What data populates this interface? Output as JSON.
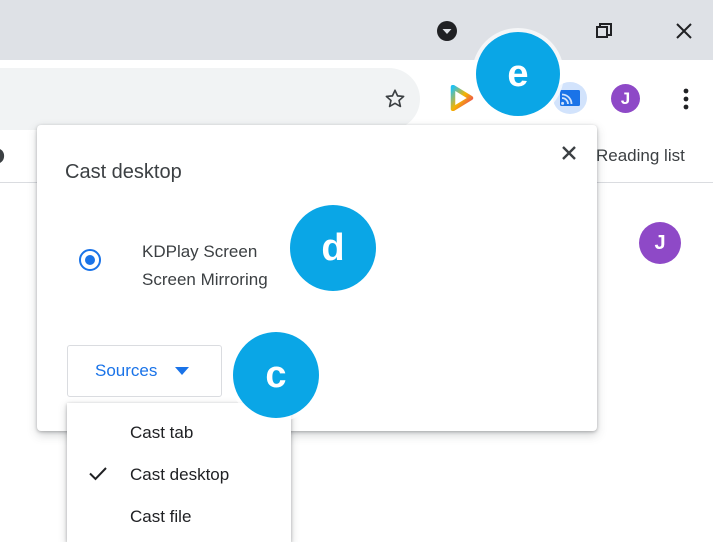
{
  "browser": {
    "profile_initial": "J",
    "cast_icon_active_color": "#1a73e8",
    "reading_list_label": "Reading list"
  },
  "cast_dialog": {
    "title": "Cast desktop",
    "sink": {
      "line1": "KDPlay Screen",
      "line2": "Screen Mirroring",
      "selected": true
    },
    "sources_label": "Sources"
  },
  "sources_menu": {
    "items": [
      {
        "label": "Cast tab",
        "checked": false
      },
      {
        "label": "Cast desktop",
        "checked": true
      },
      {
        "label": "Cast file",
        "checked": false
      }
    ]
  },
  "page": {
    "avatar_initial": "J"
  },
  "callouts": {
    "c": "c",
    "d": "d",
    "e": "e"
  },
  "colors": {
    "accent": "#1a73e8",
    "callout": "#0aa6e6",
    "avatar": "#8e49c7"
  }
}
